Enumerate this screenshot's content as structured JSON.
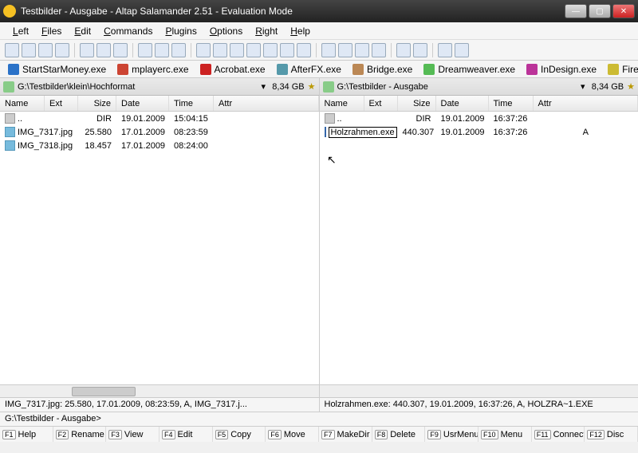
{
  "title": "Testbilder - Ausgabe - Altap Salamander 2.51 - Evaluation Mode",
  "menu": {
    "left": "Left",
    "files": "Files",
    "edit": "Edit",
    "commands": "Commands",
    "plugins": "Plugins",
    "options": "Options",
    "right": "Right",
    "help": "Help"
  },
  "shortcuts": [
    {
      "label": "StartStarMoney.exe",
      "color": "#2a72c8"
    },
    {
      "label": "mplayerc.exe",
      "color": "#c43"
    },
    {
      "label": "Acrobat.exe",
      "color": "#c22"
    },
    {
      "label": "AfterFX.exe",
      "color": "#59a"
    },
    {
      "label": "Bridge.exe",
      "color": "#b85"
    },
    {
      "label": "Dreamweaver.exe",
      "color": "#5b5"
    },
    {
      "label": "InDesign.exe",
      "color": "#b39"
    },
    {
      "label": "Fireworks.exe",
      "color": "#cb3"
    }
  ],
  "left_panel": {
    "path": "G:\\Testbilder\\klein\\Hochformat",
    "free": "8,34 GB",
    "cols": {
      "name": "Name",
      "ext": "Ext",
      "size": "Size",
      "date": "Date",
      "time": "Time",
      "attr": "Attr"
    },
    "rows": [
      {
        "name": "..",
        "size": "DIR",
        "date": "19.01.2009",
        "time": "15:04:15",
        "attr": "",
        "icon": "up"
      },
      {
        "name": "IMG_7317.jpg",
        "size": "25.580",
        "date": "17.01.2009",
        "time": "08:23:59",
        "attr": "",
        "icon": "img"
      },
      {
        "name": "IMG_7318.jpg",
        "size": "18.457",
        "date": "17.01.2009",
        "time": "08:24:00",
        "attr": "",
        "icon": "img"
      }
    ],
    "status": "IMG_7317.jpg: 25.580, 17.01.2009, 08:23:59, A, IMG_7317.j..."
  },
  "right_panel": {
    "path": "G:\\Testbilder - Ausgabe",
    "free": "8,34 GB",
    "cols": {
      "name": "Name",
      "ext": "Ext",
      "size": "Size",
      "date": "Date",
      "time": "Time",
      "attr": "Attr"
    },
    "rows": [
      {
        "name": "..",
        "size": "DIR",
        "date": "19.01.2009",
        "time": "16:37:26",
        "attr": "",
        "icon": "up"
      },
      {
        "name": "Holzrahmen.exe",
        "size": "440.307",
        "date": "19.01.2009",
        "time": "16:37:26",
        "attr": "A",
        "icon": "exe",
        "selected": true
      }
    ],
    "status": "Holzrahmen.exe: 440.307, 19.01.2009, 16:37:26, A, HOLZRA~1.EXE"
  },
  "cmdline": "G:\\Testbilder - Ausgabe>",
  "fkeys": [
    {
      "k": "F1",
      "l": "Help"
    },
    {
      "k": "F2",
      "l": "Rename"
    },
    {
      "k": "F3",
      "l": "View"
    },
    {
      "k": "F4",
      "l": "Edit"
    },
    {
      "k": "F5",
      "l": "Copy"
    },
    {
      "k": "F6",
      "l": "Move"
    },
    {
      "k": "F7",
      "l": "MakeDir"
    },
    {
      "k": "F8",
      "l": "Delete"
    },
    {
      "k": "F9",
      "l": "UsrMenu"
    },
    {
      "k": "F10",
      "l": "Menu"
    },
    {
      "k": "F11",
      "l": "Connect"
    },
    {
      "k": "F12",
      "l": "Disc"
    }
  ]
}
